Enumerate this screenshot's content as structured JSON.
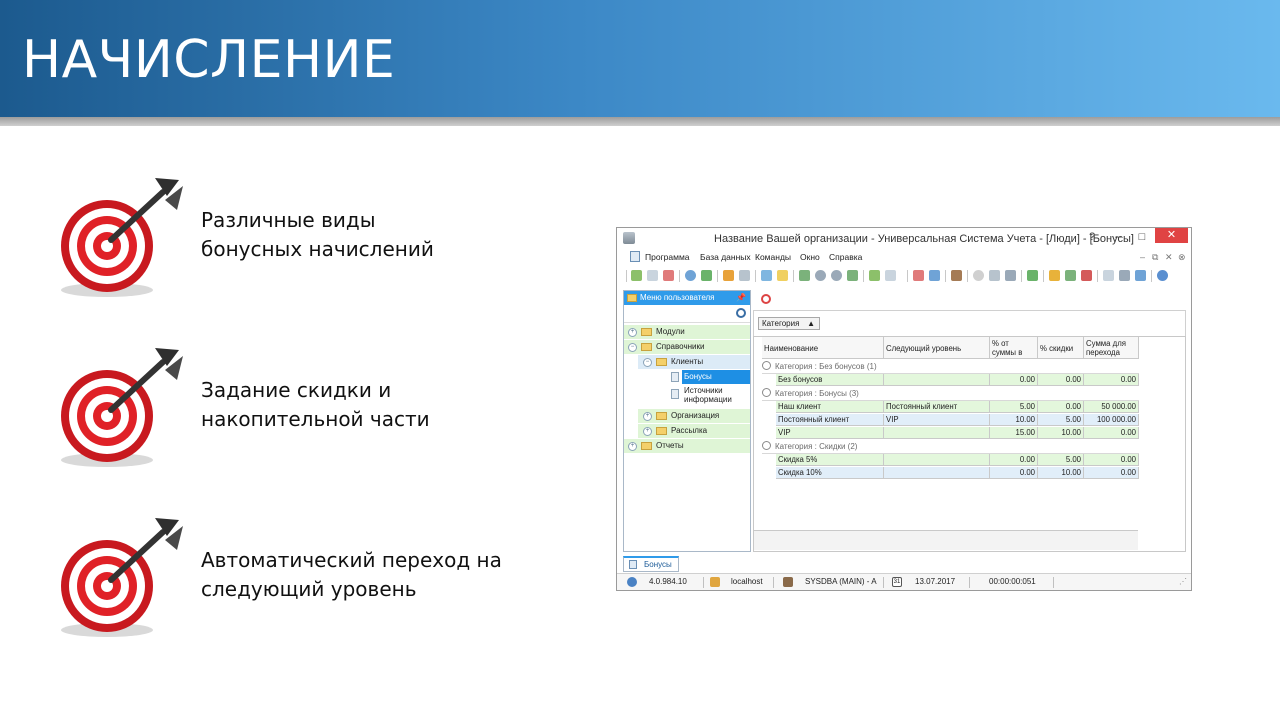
{
  "slide": {
    "title": "НАЧИСЛЕНИЕ",
    "bullets": [
      {
        "line1": "Различные виды",
        "line2": "бонусных начислений"
      },
      {
        "line1": "Задание скидки и",
        "line2": "накопительной части"
      },
      {
        "line1": "Автоматический переход на",
        "line2": "следующий уровень"
      }
    ]
  },
  "window": {
    "title": "Название Вашей организации - Универсальная Система Учета - [Люди] - [Бонусы]",
    "controls": {
      "help": "?",
      "minimize": "–",
      "maximize": "□",
      "close": "✕"
    },
    "menu": [
      "Программа",
      "База данных",
      "Команды",
      "Окно",
      "Справка"
    ],
    "mdi": {
      "minimize": "–",
      "restore": "⧉",
      "close": "✕",
      "extra": "⊗"
    }
  },
  "left_panel": {
    "header": "Меню пользователя",
    "pin": "📌",
    "tree": [
      {
        "label": "Модули",
        "toggle": "+"
      },
      {
        "label": "Справочники",
        "toggle": "−"
      },
      {
        "label": "Клиенты",
        "toggle": "−"
      },
      {
        "label": "Бонусы"
      },
      {
        "label": "Источники информации"
      },
      {
        "label": "Организация",
        "toggle": "+"
      },
      {
        "label": "Рассылка",
        "toggle": "+"
      },
      {
        "label": "Отчеты",
        "toggle": "+"
      }
    ]
  },
  "grid": {
    "group_chip": "Категория",
    "group_chip_arrow": "▲",
    "columns": [
      "Наименование",
      "Следующий уровень",
      "% от суммы в бонусы",
      "% скидки",
      "Сумма для перехода"
    ],
    "groups": [
      {
        "label": "Категория : Без бонусов (1)",
        "rows": [
          [
            "Без бонусов",
            "",
            "0.00",
            "0.00",
            "0.00"
          ]
        ]
      },
      {
        "label": "Категория : Бонусы (3)",
        "rows": [
          [
            "Наш клиент",
            "Постоянный клиент",
            "5.00",
            "0.00",
            "50 000.00"
          ],
          [
            "Постоянный клиент",
            "VIP",
            "10.00",
            "5.00",
            "100 000.00"
          ],
          [
            "VIP",
            "",
            "15.00",
            "10.00",
            "0.00"
          ]
        ]
      },
      {
        "label": "Категория : Скидки (2)",
        "rows": [
          [
            "Скидка 5%",
            "",
            "0.00",
            "5.00",
            "0.00"
          ],
          [
            "Скидка 10%",
            "",
            "0.00",
            "10.00",
            "0.00"
          ]
        ]
      }
    ]
  },
  "tab": {
    "label": "Бонусы"
  },
  "status": {
    "version": "4.0.984.10",
    "server": "localhost",
    "user": "SYSDBA (MAIN) - A",
    "date": "13.07.2017",
    "calendar_day": "31",
    "timer": "00:00:00:051"
  }
}
